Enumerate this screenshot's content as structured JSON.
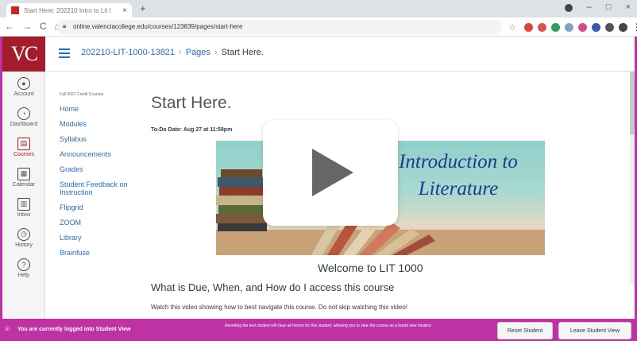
{
  "browser": {
    "tab_title": "Start Here: 202210 Intro to Lit I",
    "tab_close": "×",
    "new_tab": "+",
    "url": "online.valenciacollege.edu/courses/123839/pages/start-here",
    "back": "←",
    "forward": "→",
    "reload": "C",
    "home": "⌂",
    "minimize": "–",
    "maximize": "□",
    "close": "×"
  },
  "global_nav": {
    "logo": "VC",
    "items": [
      {
        "label": "Account",
        "icon": "account-icon",
        "glyph": "●"
      },
      {
        "label": "Dashboard",
        "icon": "dashboard-icon",
        "glyph": "◔"
      },
      {
        "label": "Courses",
        "icon": "courses-icon",
        "glyph": "▤"
      },
      {
        "label": "Calendar",
        "icon": "calendar-icon",
        "glyph": "▦"
      },
      {
        "label": "Inbox",
        "icon": "inbox-icon",
        "glyph": "▥"
      },
      {
        "label": "History",
        "icon": "history-icon",
        "glyph": "◷"
      },
      {
        "label": "Help",
        "icon": "help-icon",
        "glyph": "?"
      }
    ]
  },
  "breadcrumb": {
    "course": "202210-LIT-1000-13821",
    "section": "Pages",
    "current": "Start Here."
  },
  "course_nav": {
    "term": "Fall 2021 Credit Courses",
    "items": [
      "Home",
      "Modules",
      "Syllabus",
      "Announcements",
      "Grades",
      "Student Feedback on Instruction",
      "Flipgrid",
      "ZOOM",
      "Library",
      "Brainfuse"
    ]
  },
  "page": {
    "title": "Start Here.",
    "todo": "To-Do Date: Aug 27 at 11:59pm",
    "banner_line1": "Introduction to",
    "banner_line2": "Literature",
    "welcome": "Welcome to LIT 1000",
    "subheading": "What is Due, When, and How do I access this course",
    "paragraph": "Watch this video showing how to best navigate this course. Do not skip watching this video!"
  },
  "student_view": {
    "message": "You are currently logged into Student View",
    "note": "Resetting the test student will clear all history for this student, allowing you to view the course as a brand new student.",
    "reset_label": "Reset Student",
    "leave_label": "Leave Student View"
  },
  "colors": {
    "brand_red": "#a31c2c",
    "student_view_magenta": "#bf32a4",
    "link_blue": "#2c6cb3"
  }
}
